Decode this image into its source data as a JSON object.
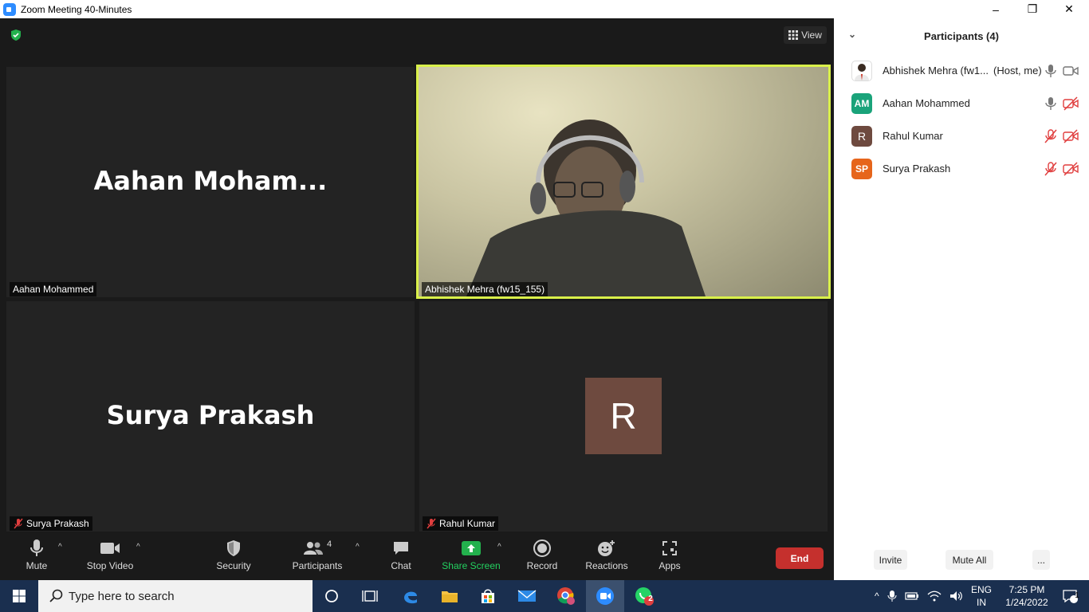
{
  "window": {
    "title": "Zoom Meeting 40-Minutes",
    "minimize": "–",
    "restore": "❐",
    "close": "✕"
  },
  "meeting": {
    "view_label": "View",
    "tiles": [
      {
        "big_text": "Aahan  Moham...",
        "name": "Aahan Mohammed",
        "muted": false
      },
      {
        "big_text": "",
        "name": "Abhishek Mehra (fw15_155)",
        "muted": false,
        "active": true
      },
      {
        "big_text": "Surya Prakash",
        "name": "Surya Prakash",
        "muted": true
      },
      {
        "avatar_letter": "R",
        "name": "Rahul Kumar",
        "muted": true
      }
    ]
  },
  "toolbar": {
    "mute": "Mute",
    "stop_video": "Stop Video",
    "security": "Security",
    "participants": "Participants",
    "participants_count": "4",
    "chat": "Chat",
    "share_screen": "Share Screen",
    "record": "Record",
    "reactions": "Reactions",
    "apps": "Apps",
    "end": "End"
  },
  "panel": {
    "title": "Participants (4)",
    "participants": [
      {
        "name": "Abhishek Mehra (fw1...",
        "status": "(Host, me)",
        "avatar": "",
        "avatar_color": "#ffffff",
        "mic_muted": false,
        "video_off": false
      },
      {
        "name": "Aahan Mohammed",
        "status": "",
        "avatar": "AM",
        "avatar_color": "#1aa37a",
        "mic_muted": false,
        "video_off": true
      },
      {
        "name": "Rahul Kumar",
        "status": "",
        "avatar": "R",
        "avatar_color": "#6e4a3f",
        "mic_muted": true,
        "video_off": true
      },
      {
        "name": "Surya Prakash",
        "status": "",
        "avatar": "SP",
        "avatar_color": "#e6651b",
        "mic_muted": true,
        "video_off": true
      }
    ],
    "invite": "Invite",
    "mute_all": "Mute All",
    "more": "..."
  },
  "taskbar": {
    "search_placeholder": "Type here to search",
    "lang_top": "ENG",
    "lang_bottom": "IN",
    "time": "7:25 PM",
    "date": "1/24/2022",
    "whatsapp_badge": "2",
    "notif_count": "1"
  }
}
